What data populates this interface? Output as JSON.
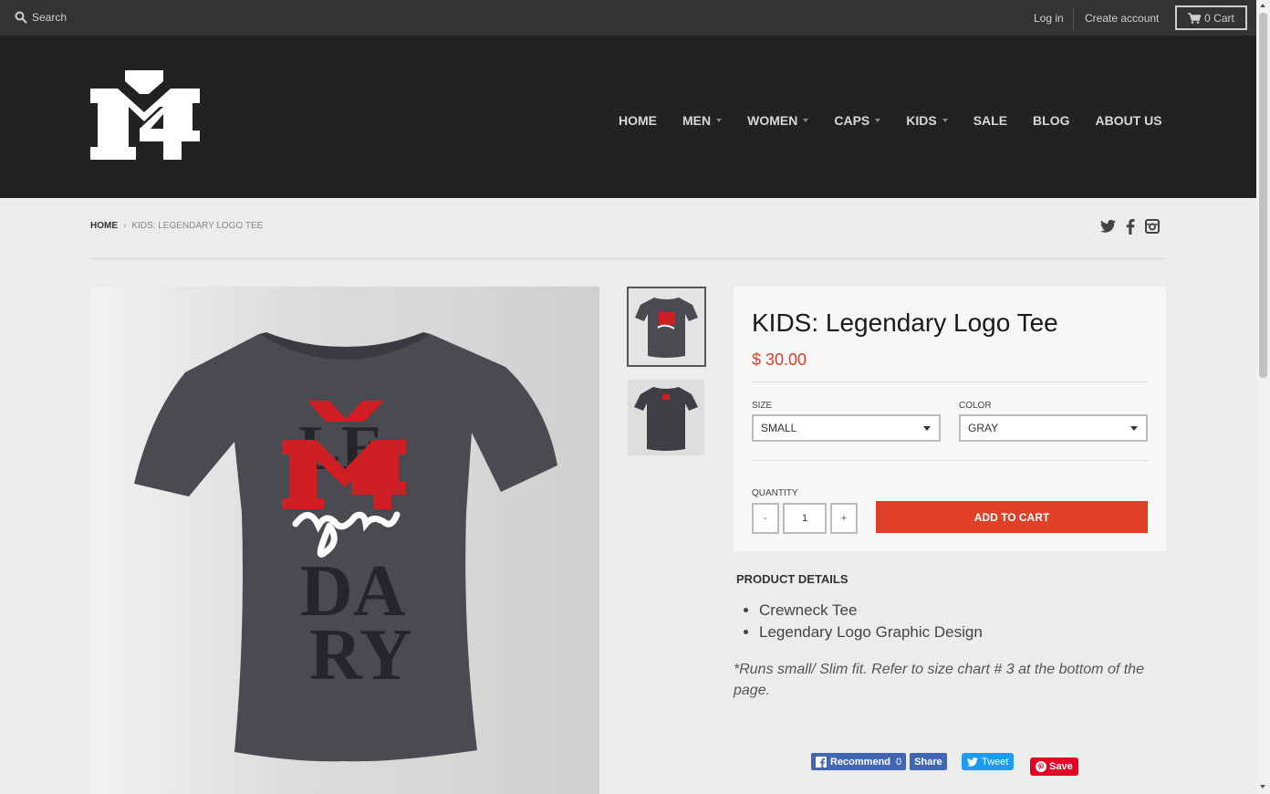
{
  "topbar": {
    "search_label": "Search",
    "login_label": "Log in",
    "create_account_label": "Create account",
    "cart_label": "0 Cart"
  },
  "nav": {
    "items": [
      {
        "label": "HOME",
        "dropdown": false
      },
      {
        "label": "MEN",
        "dropdown": true
      },
      {
        "label": "WOMEN",
        "dropdown": true
      },
      {
        "label": "CAPS",
        "dropdown": true
      },
      {
        "label": "KIDS",
        "dropdown": true
      },
      {
        "label": "SALE",
        "dropdown": false
      },
      {
        "label": "BLOG",
        "dropdown": false
      },
      {
        "label": "ABOUT US",
        "dropdown": false
      }
    ]
  },
  "breadcrumb": {
    "home": "HOME",
    "separator": "›",
    "current": "KIDS: LEGENDARY LOGO TEE"
  },
  "product": {
    "title": "KIDS: Legendary Logo Tee",
    "price": "$ 30.00",
    "size_label": "SIZE",
    "size_value": "SMALL",
    "color_label": "COLOR",
    "color_value": "GRAY",
    "quantity_label": "QUANTITY",
    "quantity_value": "1",
    "decrement_label": "-",
    "increment_label": "+",
    "add_to_cart_label": "ADD TO CART"
  },
  "details": {
    "heading": "PRODUCT DETAILS",
    "items": [
      "Crewneck Tee",
      "Legendary Logo Graphic Design"
    ],
    "note": "*Runs small/ Slim fit. Refer to size chart # 3 at the bottom of the page."
  },
  "share": {
    "fb_recommend_label": "Recommend",
    "fb_recommend_count": "0",
    "fb_share_label": "Share",
    "tweet_label": "Tweet",
    "pin_label": "Save"
  },
  "colors": {
    "accent": "#df4027",
    "price": "#d6412c",
    "topbar": "#333333",
    "header": "#222222"
  },
  "icons": [
    "search-icon",
    "cart-icon",
    "twitter-icon",
    "facebook-icon",
    "instagram-icon",
    "pinterest-icon"
  ]
}
